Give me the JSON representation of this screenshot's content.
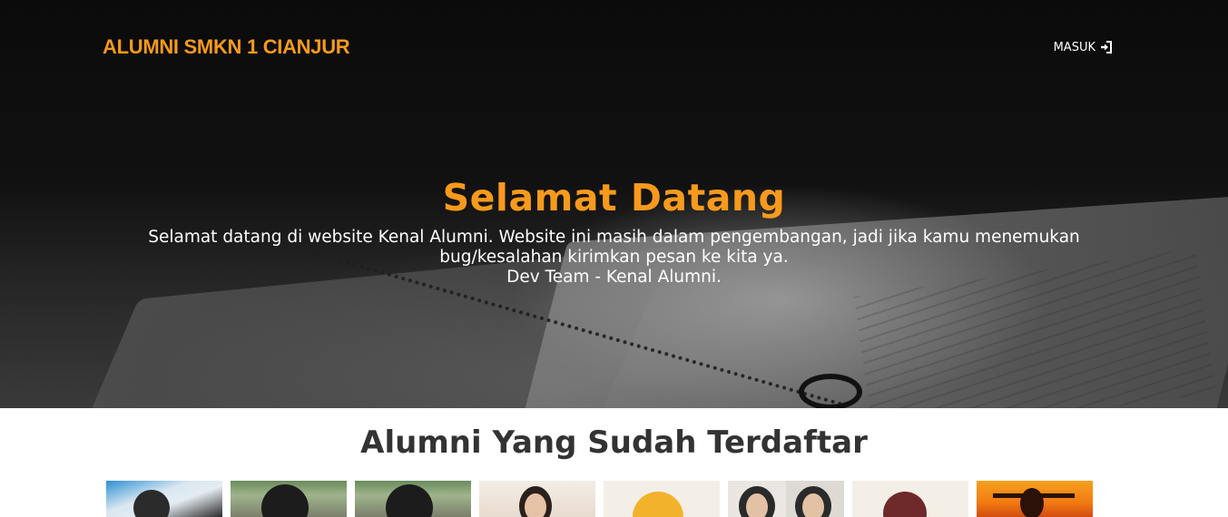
{
  "navbar": {
    "brand": "ALUMNI SMKN 1 CIANJUR",
    "login_label": "MASUK",
    "login_icon": "sign-in-icon"
  },
  "hero": {
    "title": "Selamat Datang",
    "line1": "Selamat datang di website Kenal Alumni. Website ini masih dalam pengembangan, jadi jika kamu menemukan",
    "line2": "bug/kesalahan kirimkan pesan ke kita ya.",
    "line3": "Dev Team - Kenal Alumni."
  },
  "alumni_section": {
    "title": "Alumni Yang Sudah Terdaftar",
    "thumbnail_count": 8
  },
  "colors": {
    "accent": "#f79a1c",
    "hero_text": "#ffffff",
    "heading": "#333333"
  }
}
